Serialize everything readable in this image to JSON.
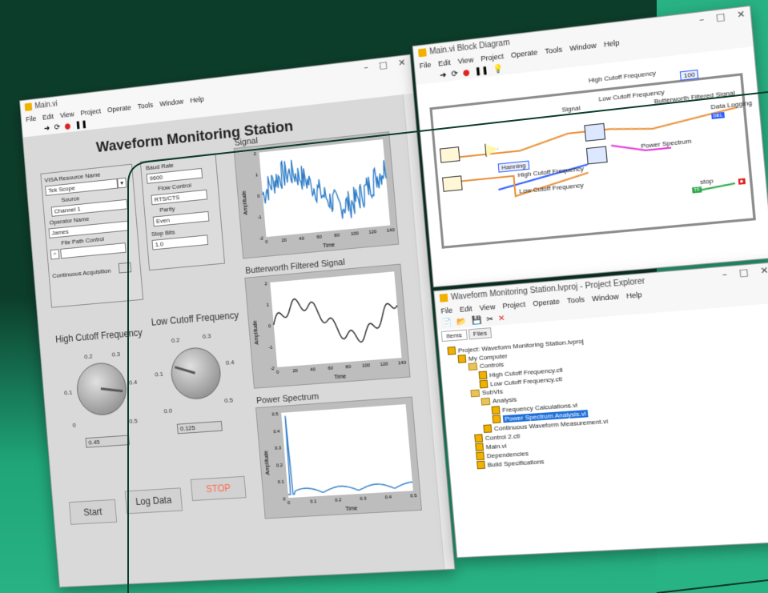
{
  "front_panel": {
    "window_title": "Main.vi",
    "menu": [
      "File",
      "Edit",
      "View",
      "Project",
      "Operate",
      "Tools",
      "Window",
      "Help"
    ],
    "title": "Waveform Monitoring Station",
    "visa_label": "VISA Resource Name",
    "visa_value": "Tek Scope",
    "source_label": "Source",
    "source_value": "Channel 1",
    "operator_label": "Operator Name",
    "operator_value": "James",
    "file_path_label": "File Path Control",
    "continuous_label": "Continuous Acquisition",
    "baud_label": "Baud Rate",
    "baud_value": "9600",
    "flow_label": "Flow Control",
    "flow_value": "RTS/CTS",
    "parity_label": "Parity",
    "parity_value": "Even",
    "stop_bits_label": "Stop Bits",
    "stop_bits_value": "1.0",
    "high_cutoff": {
      "label": "High Cutoff Frequency",
      "value": "0.45",
      "ticks": [
        "0.1",
        "0.2",
        "0.3",
        "0.4",
        "0",
        "0.5"
      ]
    },
    "low_cutoff": {
      "label": "Low Cutoff Frequency",
      "value": "0.125",
      "ticks": [
        "0.1",
        "0.2",
        "0.3",
        "0.4",
        "0.0",
        "0.5"
      ]
    },
    "buttons": {
      "start": "Start",
      "log": "Log Data",
      "stop": "STOP"
    }
  },
  "charts": {
    "signal": {
      "title": "Signal",
      "ylabel": "Amplitude",
      "xlabel": "Time",
      "yticks": [
        "2",
        "1",
        "0",
        "-1",
        "-2"
      ],
      "xticks": [
        "0",
        "20",
        "40",
        "60",
        "80",
        "100",
        "120",
        "140"
      ]
    },
    "butterworth": {
      "title": "Butterworth Filtered Signal",
      "ylabel": "Amplitude",
      "xlabel": "Time",
      "yticks": [
        "2",
        "1",
        "0",
        "-1",
        "-2"
      ],
      "xticks": [
        "0",
        "20",
        "40",
        "60",
        "80",
        "100",
        "120",
        "140"
      ]
    },
    "power": {
      "title": "Power Spectrum",
      "ylabel": "Amplitude",
      "xlabel": "Time",
      "yticks": [
        "0.5",
        "0.4",
        "0.3",
        "0.2",
        "0.1",
        "0"
      ],
      "xticks": [
        "0",
        "0.1",
        "0.2",
        "0.3",
        "0.4",
        "0.5"
      ]
    }
  },
  "block_diagram": {
    "window_title": "Main.vi Block Diagram",
    "menu": [
      "File",
      "Edit",
      "View",
      "Project",
      "Operate",
      "Tools",
      "Window",
      "Help"
    ],
    "labels": {
      "high_cutoff": "High Cutoff Frequency",
      "low_cutoff": "Low Cutoff Frequency",
      "signal": "Signal",
      "butterworth": "Butterworth Filtered Signal",
      "data_logging": "Data Logging",
      "hanning": "Hanning",
      "high_cutoff2": "High Cutoff Frequency",
      "low_cutoff2": "Low Cutoff Frequency",
      "power_spectrum": "Power Spectrum",
      "stop": "stop",
      "const_100": "100"
    }
  },
  "project_explorer": {
    "window_title": "Waveform Monitoring Station.lvproj - Project Explorer",
    "menu": [
      "File",
      "Edit",
      "View",
      "Project",
      "Operate",
      "Tools",
      "Window",
      "Help"
    ],
    "tabs": [
      "Items",
      "Files"
    ],
    "tree": [
      {
        "label": "Project: Waveform Monitoring Station.lvproj",
        "indent": 0,
        "kind": "project"
      },
      {
        "label": "My Computer",
        "indent": 1,
        "kind": "computer"
      },
      {
        "label": "Controls",
        "indent": 2,
        "kind": "folder"
      },
      {
        "label": "High Cutoff Frequency.ctl",
        "indent": 3,
        "kind": "file"
      },
      {
        "label": "Low Cutoff Frequency.ctl",
        "indent": 3,
        "kind": "file"
      },
      {
        "label": "SubVIs",
        "indent": 2,
        "kind": "folder"
      },
      {
        "label": "Analysis",
        "indent": 3,
        "kind": "folder"
      },
      {
        "label": "Frequency Calculations.vi",
        "indent": 4,
        "kind": "file"
      },
      {
        "label": "Power Spectrum Analysis.vi",
        "indent": 4,
        "kind": "file",
        "selected": true
      },
      {
        "label": "Continuous Waveform Measurement.vi",
        "indent": 3,
        "kind": "file"
      },
      {
        "label": "Control 2.ctl",
        "indent": 2,
        "kind": "file"
      },
      {
        "label": "Main.vi",
        "indent": 2,
        "kind": "file"
      },
      {
        "label": "Dependencies",
        "indent": 2,
        "kind": "deps"
      },
      {
        "label": "Build Specifications",
        "indent": 2,
        "kind": "build"
      }
    ]
  },
  "colors": {
    "dark_bg": "#0c3d2b",
    "teal": "#28b384",
    "accent_blue": "#1e6fd9",
    "wire_orange": "#e8913a",
    "wire_pink": "#e23bd8",
    "wire_blue": "#2b5cff",
    "wire_green": "#2aa84a"
  }
}
